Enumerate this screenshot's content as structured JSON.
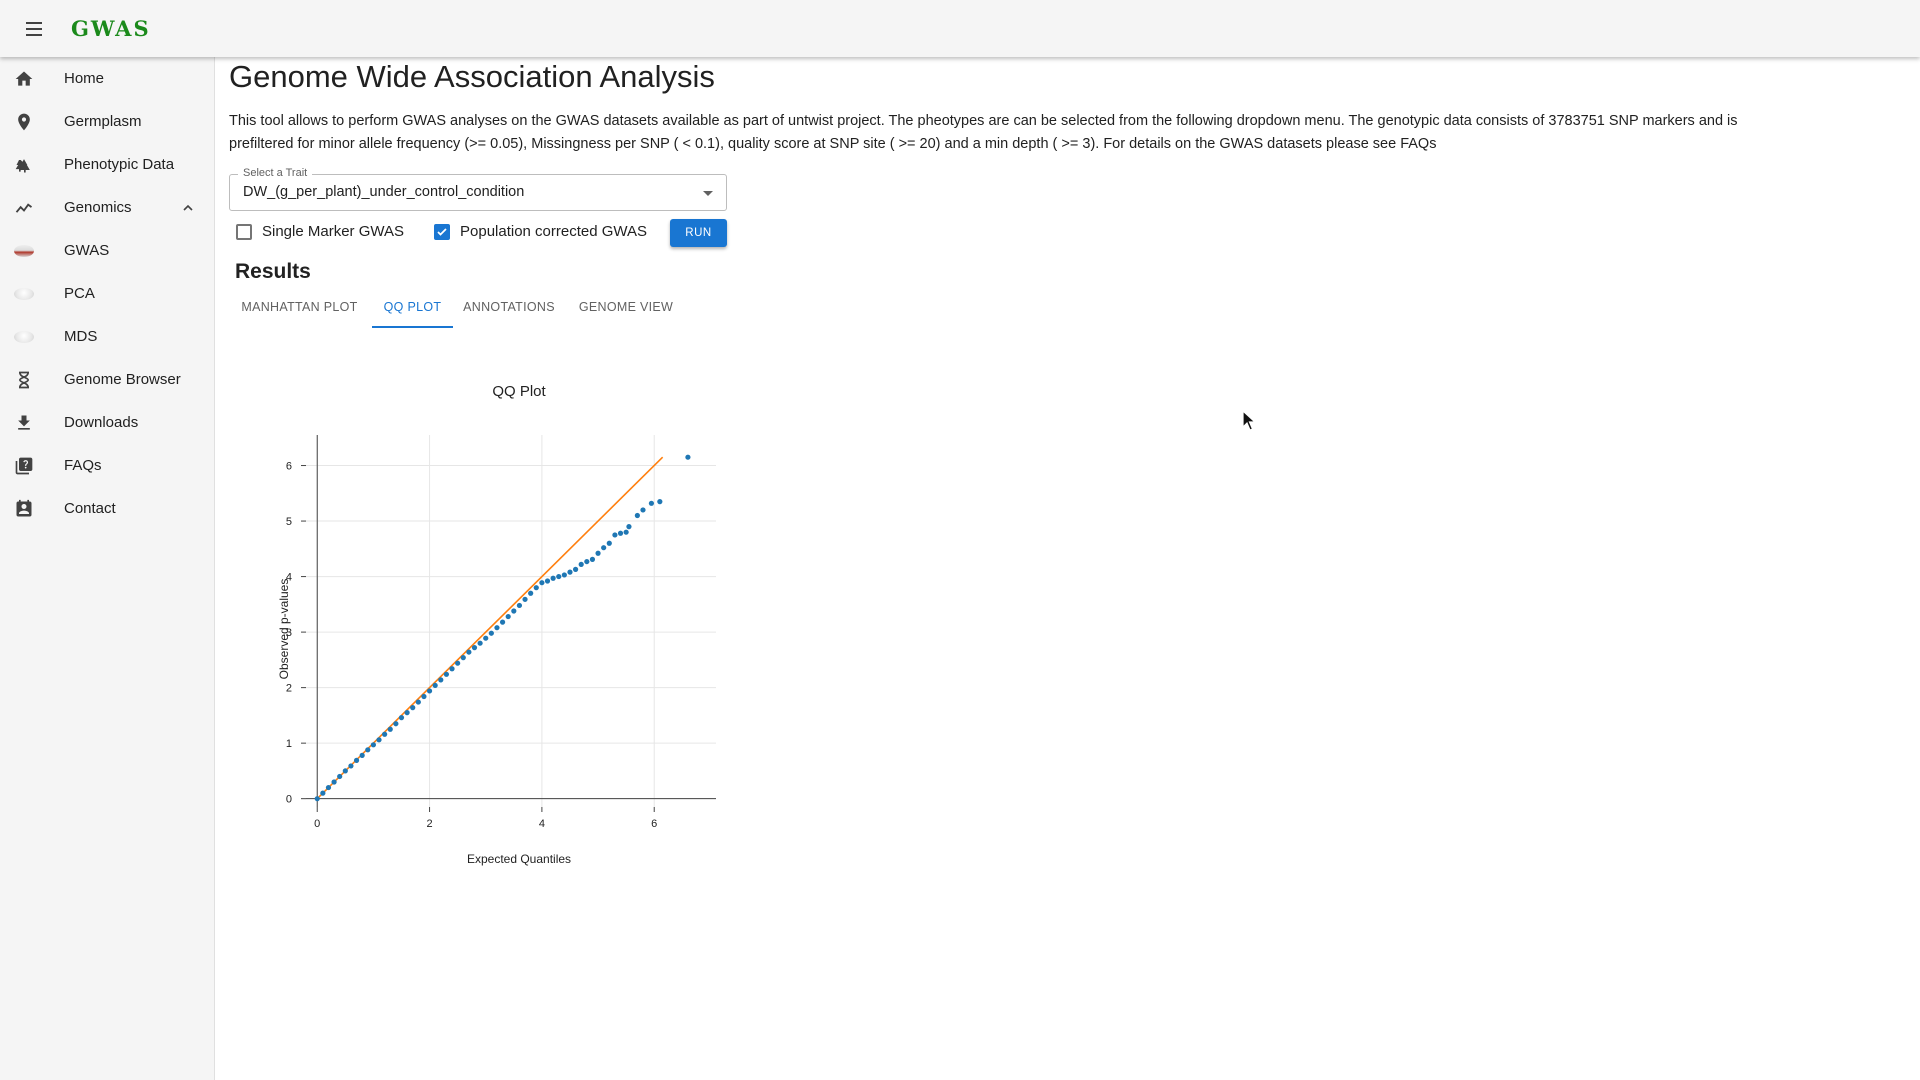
{
  "app": {
    "brand": "GWAS"
  },
  "sidebar": {
    "items": [
      {
        "label": "Home",
        "icon": "home-icon"
      },
      {
        "label": "Germplasm",
        "icon": "location-pin-icon"
      },
      {
        "label": "Phenotypic Data",
        "icon": "forest-icon"
      },
      {
        "label": "Genomics",
        "icon": "trend-line-icon",
        "expanded": true
      },
      {
        "label": "GWAS",
        "icon": "gwas-thumbnail-icon"
      },
      {
        "label": "PCA",
        "icon": "pca-thumbnail-icon"
      },
      {
        "label": "MDS",
        "icon": "mds-thumbnail-icon"
      },
      {
        "label": "Genome Browser",
        "icon": "dna-icon"
      },
      {
        "label": "Downloads",
        "icon": "download-icon"
      },
      {
        "label": "FAQs",
        "icon": "help-book-icon"
      },
      {
        "label": "Contact",
        "icon": "contact-card-icon"
      }
    ]
  },
  "main": {
    "title": "Genome Wide Association Analysis",
    "description": "This tool allows to perform GWAS analyses on the GWAS datasets available as part of untwist project. The pheotypes are can be selected from the following dropdown menu. The genotypic data consists of 3783751 SNP markers and is prefiltered for minor allele frequency (>= 0.05), Missingness per SNP ( < 0.1), quality score at SNP site ( >= 20) and a min depth ( >= 3). For details on the GWAS datasets please see FAQs",
    "trait_select": {
      "label": "Select a Trait",
      "value": "DW_(g_per_plant)_under_control_condition"
    },
    "options": {
      "single_marker": {
        "label": "Single Marker GWAS",
        "checked": false
      },
      "population_corrected": {
        "label": "Population corrected GWAS",
        "checked": true
      }
    },
    "run_label": "RUN",
    "results_title": "Results",
    "tabs": [
      {
        "label": "MANHATTAN PLOT",
        "active": false
      },
      {
        "label": "QQ PLOT",
        "active": true
      },
      {
        "label": "ANNOTATIONS",
        "active": false
      },
      {
        "label": "GENOME VIEW",
        "active": false
      }
    ]
  },
  "colors": {
    "accent": "#1976d2",
    "brand": "#1b8a1b",
    "points": "#1f77b4",
    "reference_line": "#ff7f0e"
  },
  "chart_data": {
    "type": "scatter",
    "title": "QQ Plot",
    "xlabel": "Expected Quantiles",
    "ylabel": "Observed p-values",
    "xlim": [
      -0.2,
      7.1
    ],
    "ylim": [
      -0.15,
      6.55
    ],
    "xticks": [
      0,
      2,
      4,
      6
    ],
    "yticks": [
      0,
      1,
      2,
      3,
      4,
      5,
      6
    ],
    "grid": true,
    "reference_line": {
      "x": [
        0,
        6.15
      ],
      "y": [
        0,
        6.15
      ]
    },
    "points": {
      "x": [
        0,
        0.1,
        0.2,
        0.3,
        0.4,
        0.5,
        0.6,
        0.7,
        0.8,
        0.9,
        1.0,
        1.1,
        1.2,
        1.3,
        1.4,
        1.5,
        1.6,
        1.7,
        1.8,
        1.9,
        2.0,
        2.1,
        2.2,
        2.3,
        2.4,
        2.5,
        2.6,
        2.7,
        2.8,
        2.9,
        3.0,
        3.1,
        3.2,
        3.3,
        3.4,
        3.5,
        3.6,
        3.7,
        3.8,
        3.9,
        4.0,
        4.1,
        4.2,
        4.3,
        4.4,
        4.5,
        4.6,
        4.7,
        4.8,
        4.9,
        5.0,
        5.1,
        5.2,
        5.3,
        5.4,
        5.5,
        5.55,
        5.7,
        5.8,
        5.95,
        6.1,
        6.6
      ],
      "y": [
        0,
        0.1,
        0.2,
        0.3,
        0.4,
        0.5,
        0.59,
        0.69,
        0.78,
        0.88,
        0.97,
        1.06,
        1.16,
        1.25,
        1.35,
        1.46,
        1.55,
        1.64,
        1.74,
        1.84,
        1.94,
        2.04,
        2.14,
        2.24,
        2.34,
        2.44,
        2.54,
        2.64,
        2.72,
        2.8,
        2.89,
        2.98,
        3.08,
        3.18,
        3.28,
        3.38,
        3.48,
        3.59,
        3.7,
        3.8,
        3.89,
        3.92,
        3.97,
        4.0,
        4.03,
        4.08,
        4.13,
        4.22,
        4.27,
        4.31,
        4.42,
        4.52,
        4.6,
        4.75,
        4.78,
        4.8,
        4.9,
        5.1,
        5.2,
        5.32,
        5.35,
        6.15
      ]
    }
  }
}
